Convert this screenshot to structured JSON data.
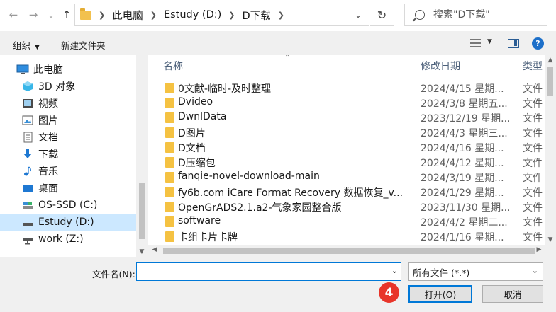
{
  "address": {
    "crumbs": [
      "此电脑",
      "Estudy (D:)",
      "D下载"
    ],
    "search_placeholder": "搜索\"D下载\""
  },
  "toolbar": {
    "organize": "组织",
    "new_folder": "新建文件夹"
  },
  "nav": {
    "items": [
      {
        "label": "此电脑",
        "icon": "pc-icon"
      },
      {
        "label": "3D 对象",
        "icon": "cube-icon"
      },
      {
        "label": "视频",
        "icon": "video-icon"
      },
      {
        "label": "图片",
        "icon": "picture-icon"
      },
      {
        "label": "文档",
        "icon": "document-icon"
      },
      {
        "label": "下载",
        "icon": "download-icon"
      },
      {
        "label": "音乐",
        "icon": "music-icon"
      },
      {
        "label": "桌面",
        "icon": "desktop-icon"
      },
      {
        "label": "OS-SSD (C:)",
        "icon": "drive-icon"
      },
      {
        "label": "Estudy (D:)",
        "icon": "drive-icon"
      },
      {
        "label": "work (Z:)",
        "icon": "network-drive-icon"
      }
    ],
    "selected": "Estudy (D:)"
  },
  "columns": {
    "name": "名称",
    "date": "修改日期",
    "type": "类型"
  },
  "files": [
    {
      "name": "0文献-临时-及时整理",
      "date": "2024/4/15 星期...",
      "type": "文件"
    },
    {
      "name": "Dvideo",
      "date": "2024/3/8 星期五...",
      "type": "文件"
    },
    {
      "name": "DwnlData",
      "date": "2023/12/19 星期...",
      "type": "文件"
    },
    {
      "name": "D图片",
      "date": "2024/4/3 星期三...",
      "type": "文件"
    },
    {
      "name": "D文档",
      "date": "2024/4/16 星期...",
      "type": "文件"
    },
    {
      "name": "D压缩包",
      "date": "2024/4/12 星期...",
      "type": "文件"
    },
    {
      "name": "fanqie-novel-download-main",
      "date": "2024/3/19 星期...",
      "type": "文件"
    },
    {
      "name": "fy6b.com iCare Format Recovery 数据恢复_v...",
      "date": "2024/1/29 星期...",
      "type": "文件"
    },
    {
      "name": "OpenGrADS2.1.a2-气象家园整合版",
      "date": "2023/11/30 星期...",
      "type": "文件"
    },
    {
      "name": "software",
      "date": "2024/4/2 星期二...",
      "type": "文件"
    },
    {
      "name": "卡组卡片卡牌",
      "date": "2024/1/16 星期...",
      "type": "文件"
    }
  ],
  "bottom": {
    "filename_label": "文件名(N):",
    "filename_value": "",
    "filetype_value": "所有文件 (*.*)",
    "open_label": "打开(O)",
    "cancel_label": "取消"
  },
  "annotation": {
    "step_badge": "4",
    "badge_color": "#e8352a"
  }
}
